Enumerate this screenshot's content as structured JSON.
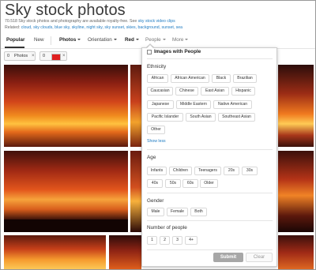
{
  "header": {
    "title": "Sky stock photos",
    "subtitle_text": "70.518 Sky stock photos and photography are available royalty-free. See",
    "subtitle_link": "sky stock video clips",
    "related_label": "Related:",
    "related_links": "cloud, sky clouds, blue sky, skyline, night sky, sky sunset, skies, background, sunset, sea"
  },
  "filterbar": {
    "tabs": [
      {
        "label": "Popular",
        "active": true
      },
      {
        "label": "New",
        "active": false
      }
    ],
    "filters": [
      {
        "label": "Photos"
      },
      {
        "label": "Orientation"
      },
      {
        "label": "Red"
      },
      {
        "label": "People"
      },
      {
        "label": "More"
      }
    ]
  },
  "chips": {
    "photos_chip": "Photos",
    "chip1_num": "0",
    "chip2_num": "0",
    "close_glyph": "×",
    "color_chip": "#e02020"
  },
  "people_panel": {
    "checkbox_label": "Images with People",
    "ethnicity": {
      "label": "Ethnicity",
      "options": [
        "African",
        "African American",
        "Black",
        "Brazilian",
        "Caucasian",
        "Chinese",
        "East Asian",
        "Hispanic",
        "Japanese",
        "Middle Eastern",
        "Native American",
        "Pacific Islander",
        "South Asian",
        "Southeast Asian",
        "Other"
      ],
      "show_less": "Show less"
    },
    "age": {
      "label": "Age",
      "options": [
        "Infants",
        "Children",
        "Teenagers",
        "20s",
        "30s",
        "40s",
        "50s",
        "60s",
        "Older"
      ]
    },
    "gender": {
      "label": "Gender",
      "options": [
        "Male",
        "Female",
        "Both"
      ]
    },
    "number_of_people": {
      "label": "Number of people",
      "options": [
        "1",
        "2",
        "3",
        "4+"
      ]
    },
    "submit_label": "Submit",
    "clear_label": "Clear"
  }
}
